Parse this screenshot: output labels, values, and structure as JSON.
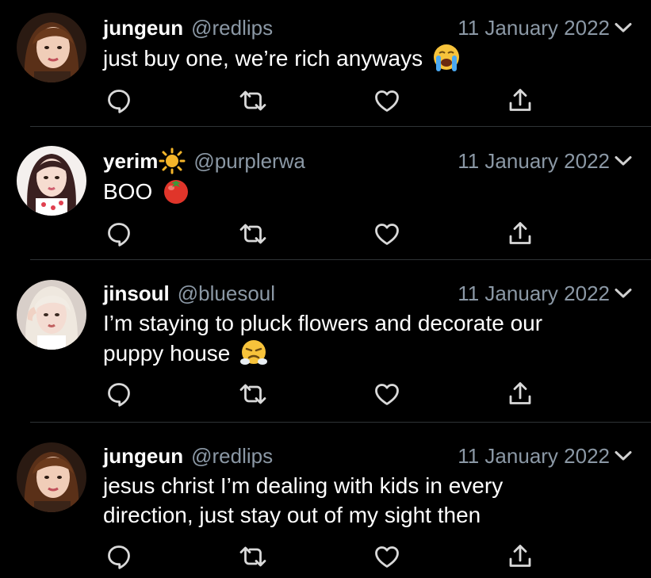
{
  "tweets": [
    {
      "name": "jungeun",
      "handle": "@redlips",
      "date": "11 January 2022",
      "lines": [
        "just buy one, we’re rich anyways"
      ],
      "emoji": "crying-face",
      "avatar": "avatar-jungeun"
    },
    {
      "name": "yerim",
      "name_badge": "sun",
      "handle": "@purplerwa",
      "date": "11 January 2022",
      "lines": [
        "BOO"
      ],
      "emoji": "tomato",
      "avatar": "avatar-yerim"
    },
    {
      "name": "jinsoul",
      "handle": "@bluesoul",
      "date": "11 January 2022",
      "lines": [
        "I’m staying to pluck flowers and decorate our",
        "puppy house"
      ],
      "emoji": "face-with-steam",
      "avatar": "avatar-jinsoul"
    },
    {
      "name": "jungeun",
      "handle": "@redlips",
      "date": "11 January 2022",
      "lines": [
        "jesus christ I’m dealing with kids in every",
        "direction, just stay out of my sight then"
      ],
      "emoji": "",
      "avatar": "avatar-jungeun"
    }
  ],
  "colors": {
    "background": "#000000",
    "text": "#ffffff",
    "secondary": "#8b98a5",
    "divider": "#2f3336"
  },
  "action_icons": [
    "reply-icon",
    "retweet-icon",
    "like-icon",
    "share-icon"
  ]
}
